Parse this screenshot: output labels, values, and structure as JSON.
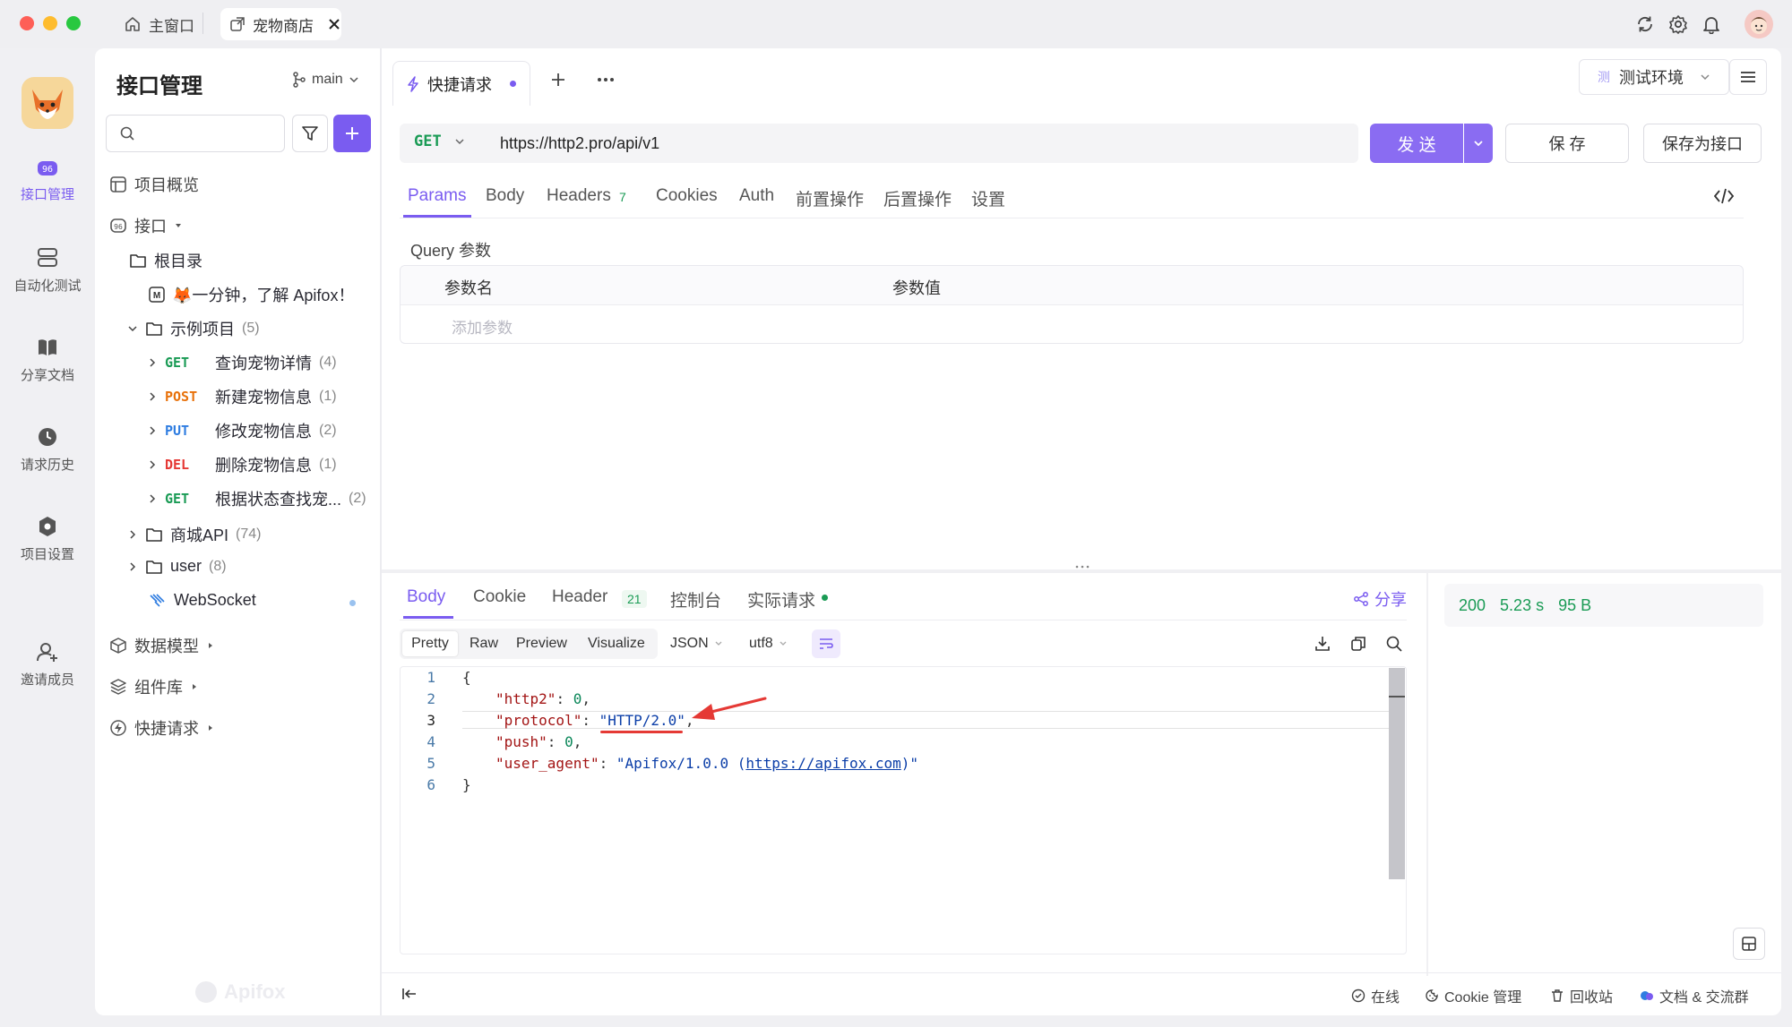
{
  "titlebar": {
    "home_tab": "主窗口",
    "active_tab": "宠物商店"
  },
  "rail": [
    {
      "label": "接口管理",
      "icon": "api-icon"
    },
    {
      "label": "自动化测试",
      "icon": "database-icon"
    },
    {
      "label": "分享文档",
      "icon": "book-icon"
    },
    {
      "label": "请求历史",
      "icon": "clock-icon"
    },
    {
      "label": "项目设置",
      "icon": "gear-icon"
    },
    {
      "label": "邀请成员",
      "icon": "add-user-icon"
    }
  ],
  "sidebar": {
    "title": "接口管理",
    "branch": "main",
    "overview": "项目概览",
    "api_section": "接口",
    "root": "根目录",
    "intro_doc": "🦊一分钟，了解 Apifox！",
    "folder": {
      "name": "示例项目",
      "count": "(5)"
    },
    "endpoints": [
      {
        "method": "GET",
        "name": "查询宠物详情",
        "count": "(4)",
        "color": "#1a9b55"
      },
      {
        "method": "POST",
        "name": "新建宠物信息",
        "count": "(1)",
        "color": "#e8710a"
      },
      {
        "method": "PUT",
        "name": "修改宠物信息",
        "count": "(2)",
        "color": "#2f7de1"
      },
      {
        "method": "DEL",
        "name": "删除宠物信息",
        "count": "(1)",
        "color": "#e53935"
      },
      {
        "method": "GET",
        "name": "根据状态查找宠...",
        "count": "(2)",
        "color": "#1a9b55"
      }
    ],
    "shop": {
      "name": "商城API",
      "count": "(74)"
    },
    "user": {
      "name": "user",
      "count": "(8)"
    },
    "websocket": "WebSocket",
    "data_model": "数据模型",
    "components": "组件库",
    "quick_request": "快捷请求",
    "watermark": "Apifox"
  },
  "request": {
    "tab_label": "快捷请求",
    "env": "测试环境",
    "env_badge": "测",
    "method": "GET",
    "url": "https://http2.pro/api/v1",
    "send": "发 送",
    "save": "保 存",
    "save_as": "保存为接口",
    "tabs": [
      "Params",
      "Body",
      "Headers",
      "Cookies",
      "Auth",
      "前置操作",
      "后置操作",
      "设置"
    ],
    "headers_count": "7",
    "query_title": "Query 参数",
    "col_name": "参数名",
    "col_value": "参数值",
    "add_param_placeholder": "添加参数"
  },
  "response": {
    "tabs": [
      "Body",
      "Cookie",
      "Header",
      "控制台",
      "实际请求"
    ],
    "header_count": "21",
    "share": "分享",
    "view_modes": [
      "Pretty",
      "Raw",
      "Preview",
      "Visualize"
    ],
    "format": "JSON",
    "encoding": "utf8",
    "status": "200",
    "time": "5.23 s",
    "size": "95 B",
    "code": [
      {
        "n": "1",
        "text": "{"
      },
      {
        "n": "2",
        "key": "\"http2\"",
        "val": "0",
        "type": "num",
        "tail": ","
      },
      {
        "n": "3",
        "key": "\"protocol\"",
        "val": "\"HTTP/2.0\"",
        "type": "str",
        "tail": ","
      },
      {
        "n": "4",
        "key": "\"push\"",
        "val": "0",
        "type": "num",
        "tail": ","
      },
      {
        "n": "5",
        "key": "\"user_agent\"",
        "val_pre": "\"Apifox/1.0.0 (",
        "link": "https://apifox.com",
        "val_post": ")\"",
        "type": "link"
      },
      {
        "n": "6",
        "text": "}"
      }
    ]
  },
  "statusbar": {
    "online": "在线",
    "cookie": "Cookie 管理",
    "recycle": "回收站",
    "docs": "文档 & 交流群"
  },
  "colors": {
    "accent": "#7a5cf0",
    "get": "#1a9b55",
    "post": "#e8710a",
    "put": "#2f7de1",
    "del": "#e53935",
    "annotation": "#e53935"
  }
}
